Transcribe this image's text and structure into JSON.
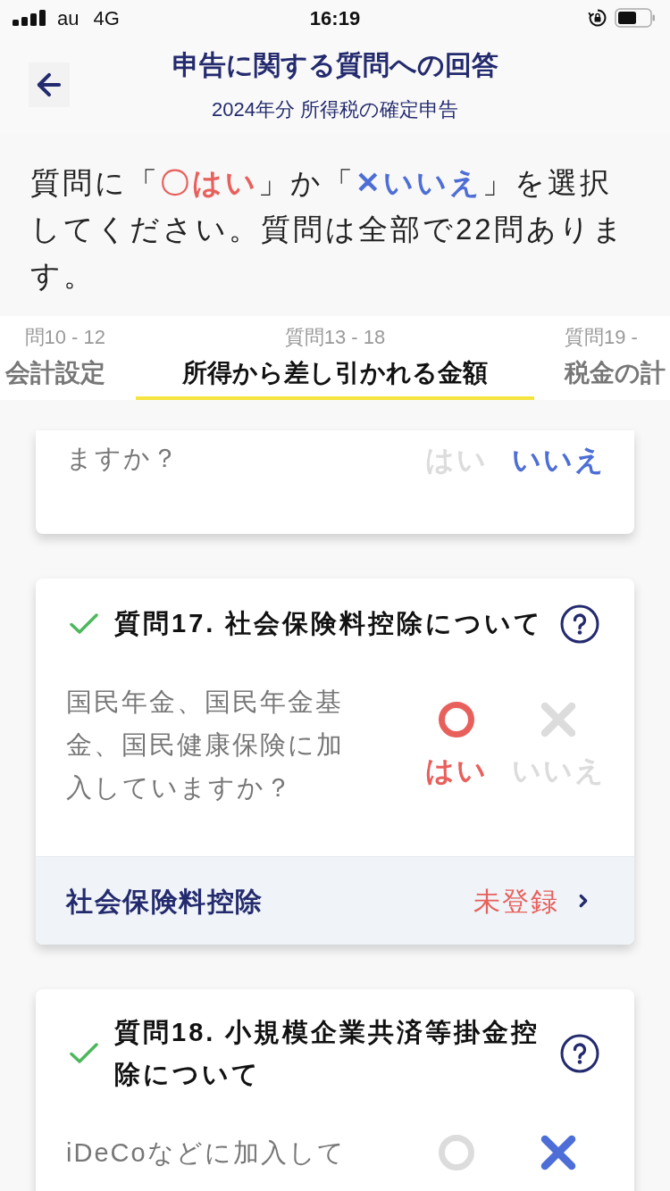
{
  "status_bar": {
    "carrier": "au",
    "network": "4G",
    "time": "16:19"
  },
  "header": {
    "title": "申告に関する質問への回答",
    "subtitle": "2024年分 所得税の確定申告"
  },
  "instruction": [
    {
      "kind": "plain",
      "text": "質問に「"
    },
    {
      "kind": "yes",
      "text": "〇はい"
    },
    {
      "kind": "plain",
      "text": "」か「"
    },
    {
      "kind": "no",
      "text": "✕いいえ"
    },
    {
      "kind": "plain",
      "text": "」を選択してください。質問は全部で22問あります。"
    }
  ],
  "tabs": [
    {
      "range": "問10 - 12",
      "label": "会計設定",
      "selected": false
    },
    {
      "range": "質問13 - 18",
      "label": "所得から差し引かれる金額",
      "selected": true
    },
    {
      "range": "質問19 -",
      "label": "税金の計",
      "selected": false
    }
  ],
  "cards": [
    {
      "kind": "cut_top",
      "question": "ますか？",
      "options": [
        {
          "kind": "yes",
          "label": "はい",
          "selected": false
        },
        {
          "kind": "no",
          "label": "いいえ",
          "selected": true
        }
      ]
    },
    {
      "kind": "full",
      "answered": true,
      "title": "質問17. 社会保険料控除について",
      "question": "国民年金、国民年金基金、国民健康保険に加入していますか？",
      "options": [
        {
          "kind": "yes",
          "label": "はい",
          "selected": true
        },
        {
          "kind": "no",
          "label": "いいえ",
          "selected": false
        }
      ],
      "footer": {
        "label": "社会保険料控除",
        "status": "未登録"
      }
    },
    {
      "kind": "cut_bottom",
      "answered": true,
      "title": "質問18. 小規模企業共済等掛金控除について",
      "question": "iDeCoなどに加入して",
      "options": [
        {
          "kind": "yes",
          "selected": false
        },
        {
          "kind": "no",
          "selected": true
        }
      ]
    }
  ]
}
